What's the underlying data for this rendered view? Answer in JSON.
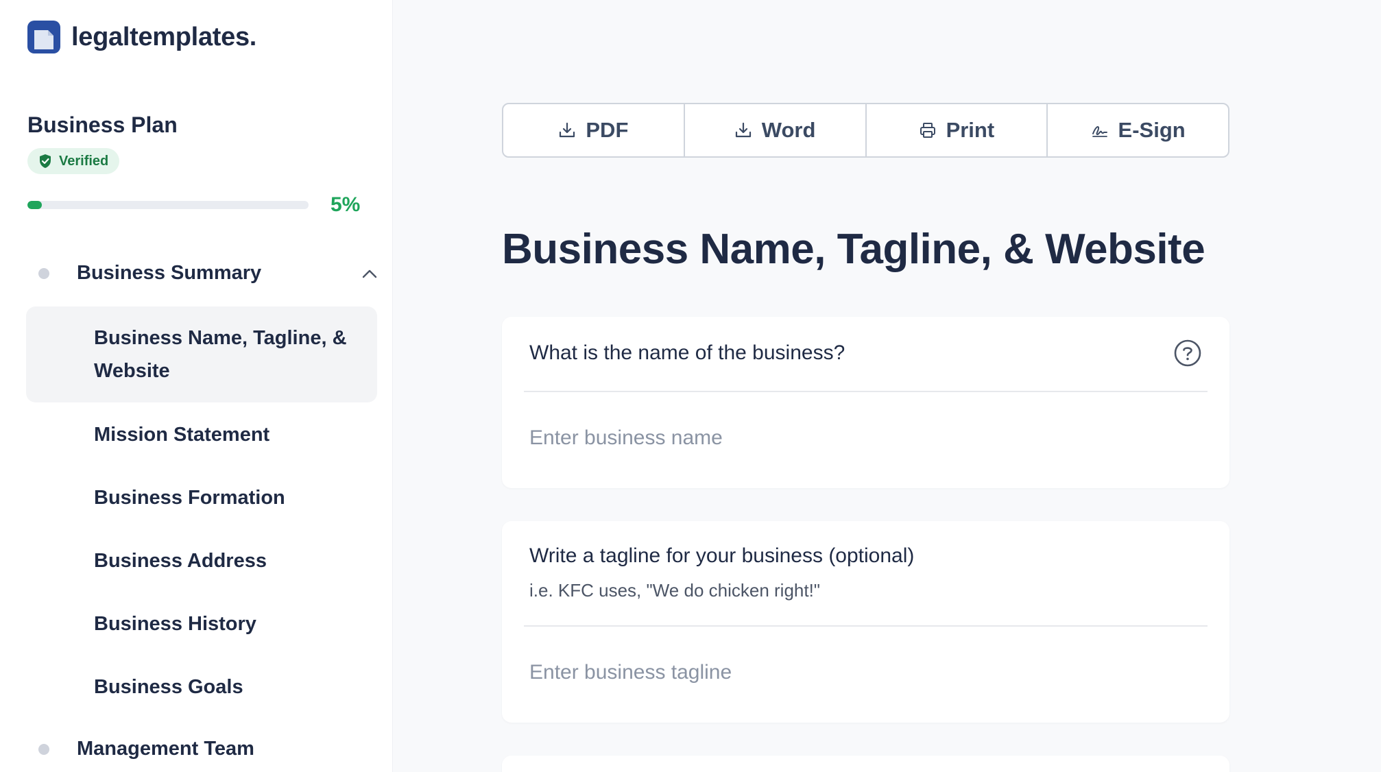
{
  "brand": {
    "name": "legaltemplates."
  },
  "document": {
    "title": "Business Plan",
    "badge": "Verified",
    "progress_percent": 5,
    "progress_label": "5%"
  },
  "sidebar": {
    "sections": [
      {
        "label": "Business Summary",
        "expanded": true
      },
      {
        "label": "Management Team",
        "expanded": false
      }
    ],
    "subitems": [
      {
        "label": "Business Name, Tagline, & Website",
        "active": true
      },
      {
        "label": "Mission Statement"
      },
      {
        "label": "Business Formation"
      },
      {
        "label": "Business Address"
      },
      {
        "label": "Business History"
      },
      {
        "label": "Business Goals"
      }
    ]
  },
  "toolbar": {
    "pdf": "PDF",
    "word": "Word",
    "print": "Print",
    "esign": "E-Sign"
  },
  "main": {
    "title": "Business Name, Tagline, & Website",
    "q1": {
      "question": "What is the name of the business?",
      "placeholder": "Enter business name",
      "value": ""
    },
    "q2": {
      "question": "Write a tagline for your business (optional)",
      "hint": "i.e. KFC uses, \"We do chicken right!\"",
      "placeholder": "Enter business tagline",
      "value": ""
    }
  },
  "colors": {
    "primary_text": "#1f2a44",
    "accent_green": "#1fa55b",
    "logo_blue": "#2a4fa3"
  }
}
